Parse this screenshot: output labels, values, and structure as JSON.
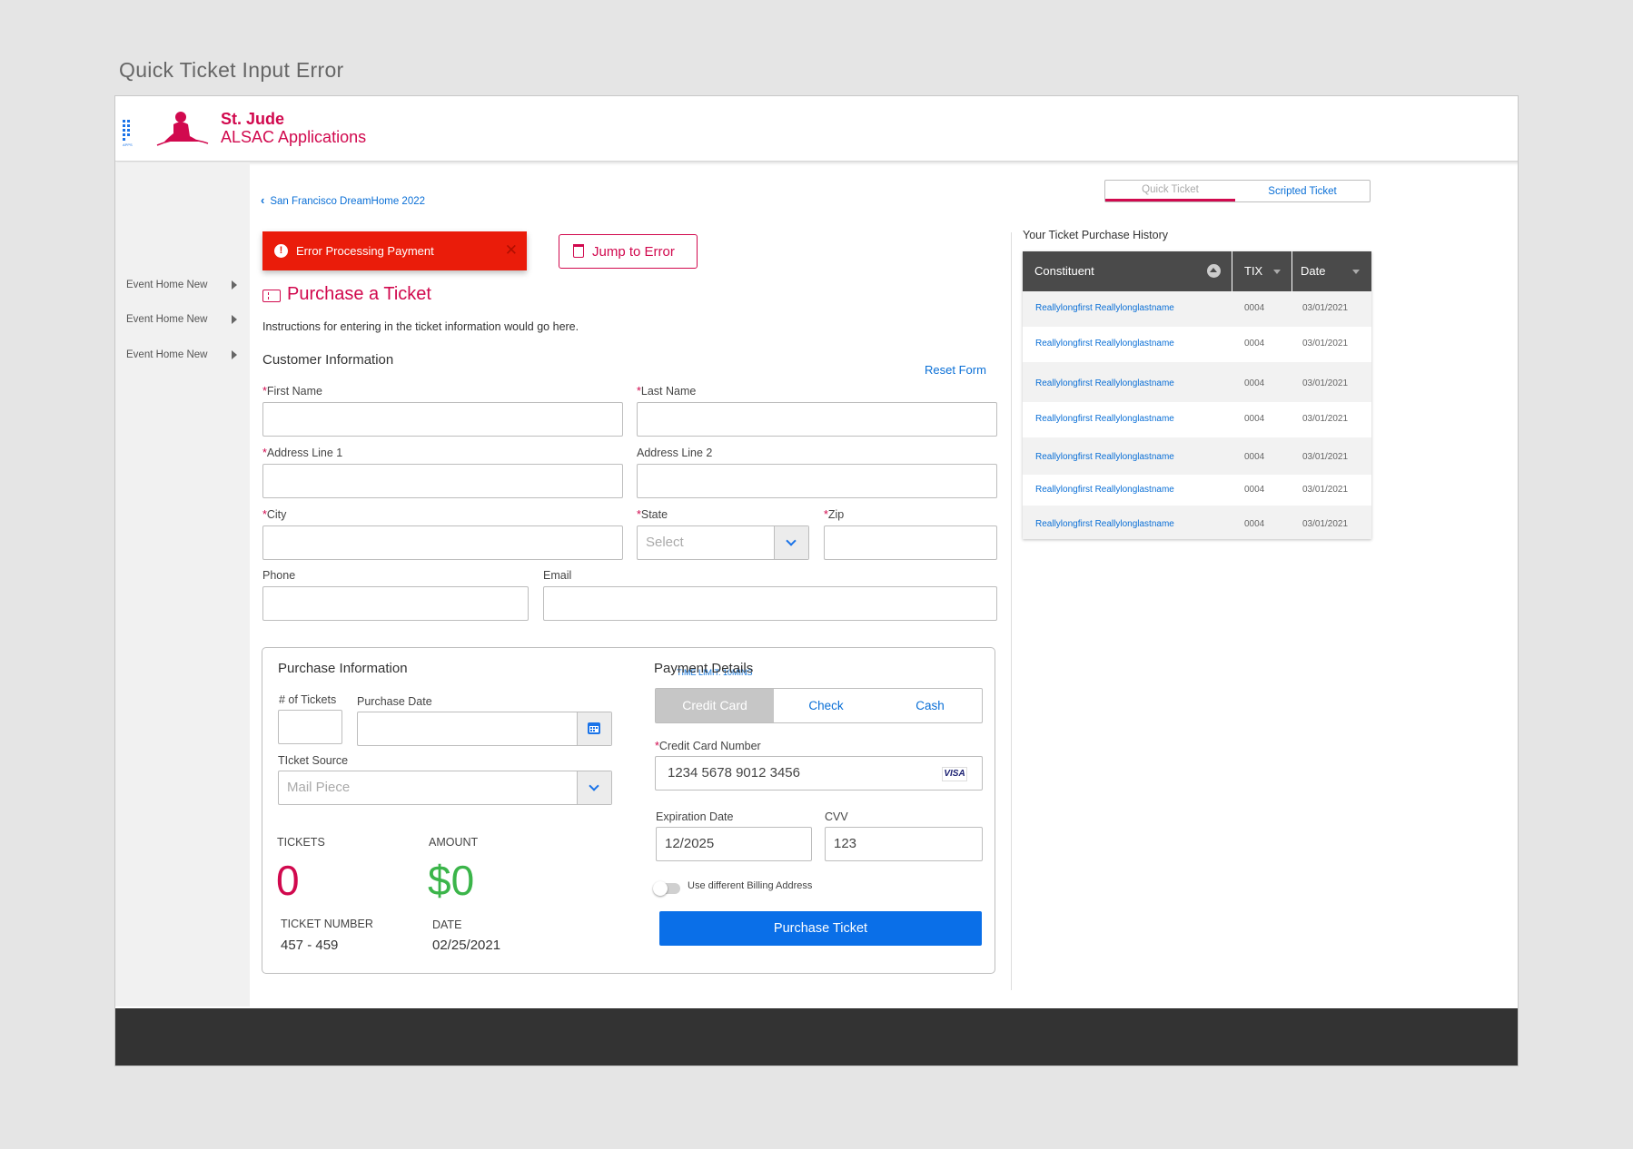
{
  "page_caption": "Quick Ticket Input Error",
  "header": {
    "apps_label": "APPS",
    "brand_line1": "St. Jude",
    "brand_line2": "ALSAC Applications"
  },
  "sidebar": {
    "items": [
      "Event Home New",
      "Event Home New",
      "Event Home New"
    ]
  },
  "breadcrumb": {
    "back_label": "San Francisco DreamHome 2022"
  },
  "error_banner": {
    "icon": "!",
    "message": "Error Processing Payment",
    "close": "✕"
  },
  "jump_button": {
    "label": "Jump to Error"
  },
  "main": {
    "title": "Purchase a Ticket",
    "instructions": "Instructions for entering in the ticket information would go here."
  },
  "customer": {
    "section_title": "Customer Information",
    "reset_label": "Reset Form",
    "first_name_label": "First Name",
    "last_name_label": "Last Name",
    "address1_label": "Address Line 1",
    "address2_label": "Address Line 2",
    "city_label": "City",
    "state_label": "State",
    "state_placeholder": "Select",
    "zip_label": "Zip",
    "phone_label": "Phone",
    "email_label": "Email",
    "required_mark": "*"
  },
  "purchase_info": {
    "section_title": "Purchase Information",
    "time_limit": "TIME LIMIT: 10MINS",
    "num_tickets_label": "# of Tickets",
    "purchase_date_label": "Purchase Date",
    "ticket_source_label": "TIcket Source",
    "ticket_source_placeholder": "Mail Piece",
    "tickets_label": "TICKETS",
    "tickets_value": "0",
    "amount_label": "AMOUNT",
    "amount_value": "$0",
    "ticket_number_label": "TICKET NUMBER",
    "ticket_number_value": "457 - 459",
    "date_label": "DATE",
    "date_value": "02/25/2021"
  },
  "payment": {
    "section_title": "Payment Details",
    "methods": [
      "Credit Card",
      "Check",
      "Cash"
    ],
    "selected_method": "Credit Card",
    "card_number_label": "Credit Card Number",
    "card_number_value": "1234 5678 9012 3456",
    "card_brand": "VISA",
    "expiration_label": "Expiration Date",
    "expiration_value": "12/2025",
    "cvv_label": "CVV",
    "cvv_value": "123",
    "billing_toggle_label": "Use different Billing Address",
    "billing_toggle_on": false,
    "purchase_button": "Purchase Ticket"
  },
  "tabs": {
    "items": [
      "Quick Ticket",
      "Scripted Ticket"
    ],
    "active": "Quick Ticket"
  },
  "history": {
    "title": "Your Ticket Purchase History",
    "columns": [
      "Constituent",
      "TIX",
      "Date"
    ],
    "rows": [
      [
        "Reallylongfirst Reallylonglastname",
        "0004",
        "03/01/2021"
      ],
      [
        "Reallylongfirst Reallylonglastname",
        "0004",
        "03/01/2021"
      ],
      [
        "Reallylongfirst Reallylonglastname",
        "0004",
        "03/01/2021"
      ],
      [
        "Reallylongfirst Reallylonglastname",
        "0004",
        "03/01/2021"
      ],
      [
        "Reallylongfirst Reallylonglastname",
        "0004",
        "03/01/2021"
      ],
      [
        "Reallylongfirst Reallylonglastname",
        "0004",
        "03/01/2021"
      ],
      [
        "Reallylongfirst Reallylonglastname",
        "0004",
        "03/01/2021"
      ]
    ]
  },
  "colors": {
    "brand": "#d1094e",
    "link": "#0a6fd6",
    "error": "#ea1c0a",
    "amount": "#3bb54a",
    "primary_button": "#0a6fe8"
  }
}
